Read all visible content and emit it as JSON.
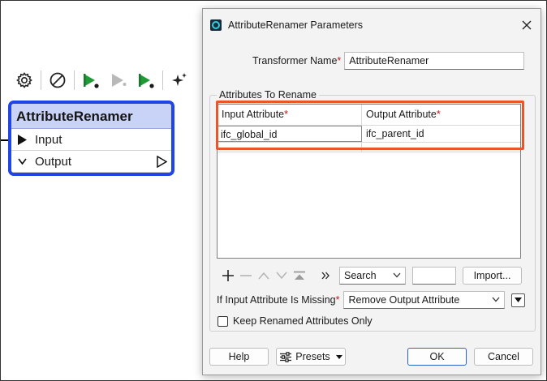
{
  "canvas": {
    "toolbar": {
      "buttons": [
        {
          "name": "gear-icon"
        },
        {
          "name": "disable-icon"
        },
        {
          "name": "run-to-this-icon"
        },
        {
          "name": "run-from-this-icon"
        },
        {
          "name": "run-just-this-icon"
        },
        {
          "name": "sparkle-icon"
        }
      ]
    },
    "node": {
      "title": "AttributeRenamer",
      "input_port": "Input",
      "output_port": "Output",
      "accent": "#1f45e8"
    }
  },
  "dialog": {
    "title": "AttributeRenamer Parameters",
    "transformer_name_label": "Transformer Name",
    "transformer_name_value": "AttributeRenamer",
    "group_label": "Attributes To Rename",
    "table": {
      "columns": [
        "Input Attribute",
        "Output Attribute"
      ],
      "rows": [
        {
          "input": "ifc_global_id",
          "output": "ifc_parent_id"
        }
      ]
    },
    "table_tools": {
      "search_label": "Search",
      "import_label": "Import..."
    },
    "missing_label": "If Input Attribute Is Missing",
    "missing_value": "Remove Output Attribute",
    "keep_label": "Keep Renamed Attributes Only",
    "keep_checked": false,
    "buttons": {
      "help": "Help",
      "presets": "Presets",
      "ok": "OK",
      "cancel": "Cancel"
    },
    "required_marker": "*",
    "highlight_color": "#e8562a"
  }
}
